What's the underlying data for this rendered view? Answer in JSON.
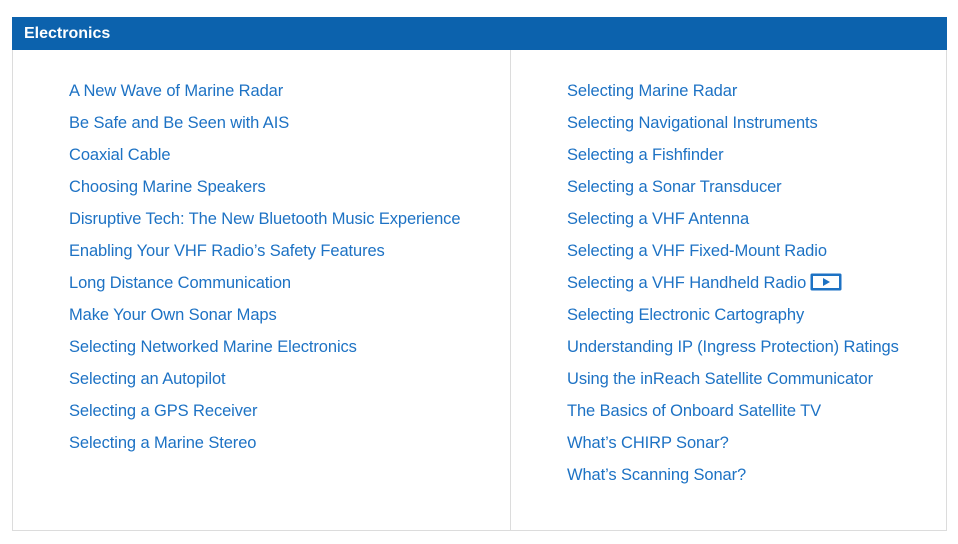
{
  "panel": {
    "title": "Electronics",
    "accent_color": "#0c62ad",
    "link_color": "#1d72c4"
  },
  "left_links": [
    "A New Wave of Marine Radar",
    "Be Safe and Be Seen with AIS",
    "Coaxial Cable",
    "Choosing Marine Speakers",
    "Disruptive Tech: The New Bluetooth Music Experience",
    "Enabling Your VHF Radio’s Safety Features",
    "Long Distance Communication",
    "Make Your Own Sonar Maps",
    "Selecting Networked Marine Electronics",
    "Selecting an Autopilot",
    "Selecting a GPS Receiver",
    "Selecting a Marine Stereo"
  ],
  "right_links": [
    "Selecting Marine Radar",
    "Selecting Navigational Instruments",
    "Selecting a Fishfinder",
    "Selecting a Sonar Transducer",
    "Selecting a VHF Antenna",
    "Selecting a VHF Fixed-Mount Radio",
    "Selecting a VHF Handheld Radio",
    "Selecting Electronic Cartography",
    "Understanding IP (Ingress Protection) Ratings",
    "Using the inReach Satellite Communicator",
    "The Basics of Onboard Satellite TV",
    "What’s CHIRP Sonar?",
    "What’s Scanning Sonar?"
  ],
  "video_icon": "video-play-icon"
}
